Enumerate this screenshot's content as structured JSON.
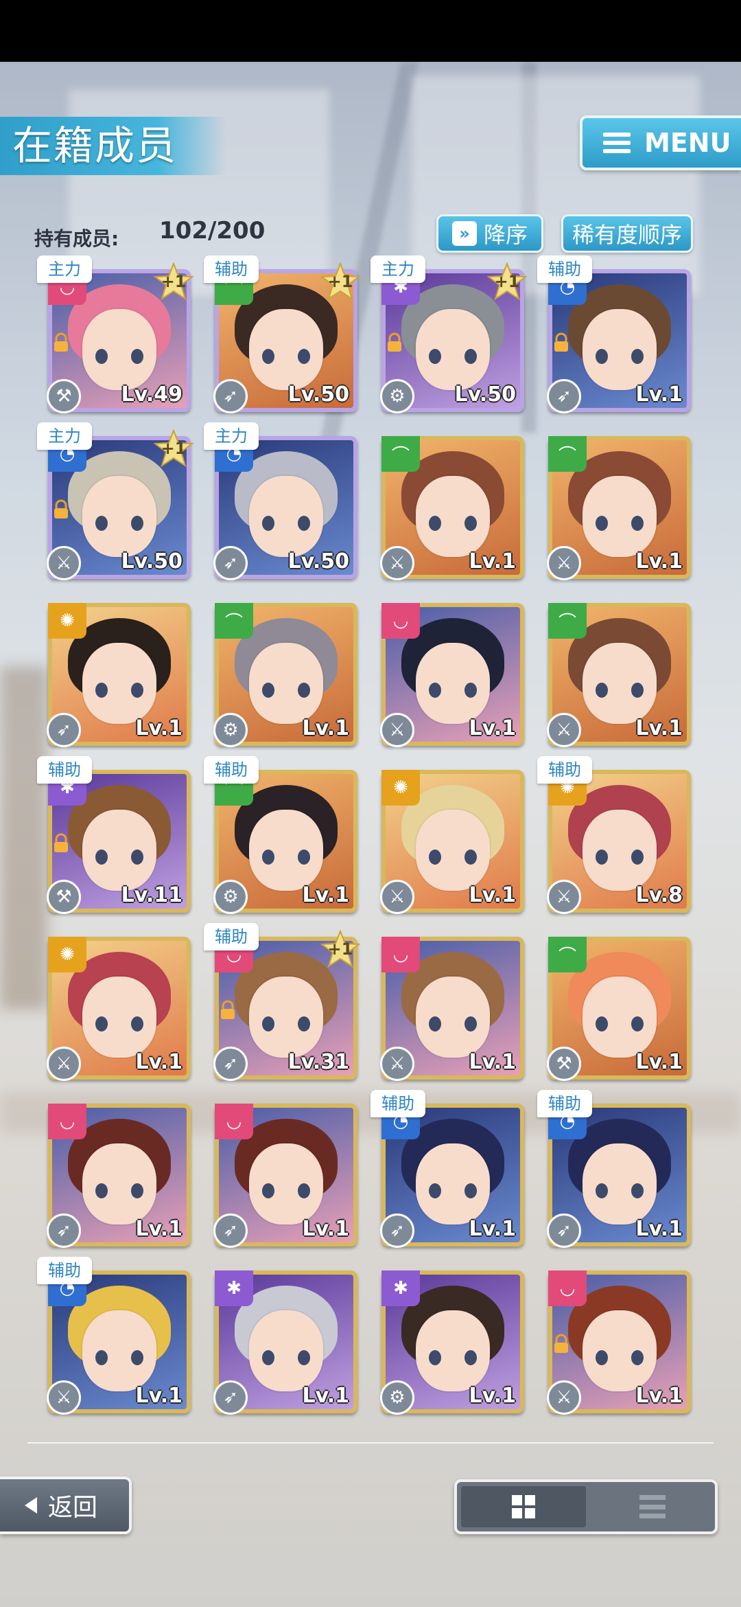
{
  "header": {
    "title": "在籍成员",
    "menu_label": "MENU"
  },
  "members": {
    "label": "持有成员:",
    "count": "102/200"
  },
  "sort": {
    "order_label": "降序",
    "order_icon": "double-chevron-down-icon",
    "key_label": "稀有度顺序"
  },
  "colors": {
    "accent": "#2e9cc8",
    "attr_pink": "#e24a7a",
    "attr_green": "#3eab46",
    "attr_orange": "#e6a21d",
    "attr_blue": "#2f6fd1",
    "attr_purple": "#8c5bd1",
    "gold_frame": "#d9b85a",
    "rainbow_frame": "#b9a4e6"
  },
  "cards": [
    {
      "role": "主力",
      "plus": "+1",
      "level": "Lv.49",
      "attr": "pink",
      "frame": "rainbow",
      "lock": true,
      "weapon": "hammer-icon",
      "hair": "#e77a9a"
    },
    {
      "role": "辅助",
      "plus": "+1",
      "level": "Lv.50",
      "attr": "green",
      "frame": "rainbow",
      "lock": false,
      "weapon": "gun-icon",
      "hair": "#3b2a24"
    },
    {
      "role": "主力",
      "plus": "+1",
      "level": "Lv.50",
      "attr": "purple",
      "frame": "rainbow",
      "lock": true,
      "weapon": "gear-icon",
      "hair": "#8a8f95"
    },
    {
      "role": "辅助",
      "plus": "",
      "level": "Lv.1",
      "attr": "blue",
      "frame": "rainbow",
      "lock": true,
      "weapon": "gun-icon",
      "hair": "#6b4a34"
    },
    {
      "role": "主力",
      "plus": "+1",
      "level": "Lv.50",
      "attr": "blue",
      "frame": "rainbow",
      "lock": true,
      "weapon": "sword-icon",
      "hair": "#c9c3b3"
    },
    {
      "role": "主力",
      "plus": "",
      "level": "Lv.50",
      "attr": "blue",
      "frame": "rainbow",
      "lock": false,
      "weapon": "gun-icon",
      "hair": "#b9bcc8"
    },
    {
      "role": "",
      "plus": "",
      "level": "Lv.1",
      "attr": "green",
      "frame": "gold",
      "lock": false,
      "weapon": "sword-icon",
      "hair": "#8a4a34"
    },
    {
      "role": "",
      "plus": "",
      "level": "Lv.1",
      "attr": "green",
      "frame": "gold",
      "lock": false,
      "weapon": "sword-icon",
      "hair": "#8a4a34"
    },
    {
      "role": "",
      "plus": "",
      "level": "Lv.1",
      "attr": "orange",
      "frame": "gold",
      "lock": false,
      "weapon": "gun-icon",
      "hair": "#2a201c"
    },
    {
      "role": "",
      "plus": "",
      "level": "Lv.1",
      "attr": "green",
      "frame": "gold",
      "lock": false,
      "weapon": "gear-icon",
      "hair": "#8f8a96"
    },
    {
      "role": "",
      "plus": "",
      "level": "Lv.1",
      "attr": "pink",
      "frame": "gold",
      "lock": false,
      "weapon": "sword-icon",
      "hair": "#1f2338"
    },
    {
      "role": "",
      "plus": "",
      "level": "Lv.1",
      "attr": "green",
      "frame": "gold",
      "lock": false,
      "weapon": "sword-icon",
      "hair": "#7a4a34"
    },
    {
      "role": "辅助",
      "plus": "",
      "level": "Lv.11",
      "attr": "purple",
      "frame": "gold",
      "lock": true,
      "weapon": "hammer-icon",
      "hair": "#8a5a34"
    },
    {
      "role": "辅助",
      "plus": "",
      "level": "Lv.1",
      "attr": "green",
      "frame": "gold",
      "lock": false,
      "weapon": "gear-icon",
      "hair": "#2a2226"
    },
    {
      "role": "",
      "plus": "",
      "level": "Lv.1",
      "attr": "orange",
      "frame": "gold",
      "lock": false,
      "weapon": "sword-icon",
      "hair": "#e6d39a"
    },
    {
      "role": "辅助",
      "plus": "",
      "level": "Lv.8",
      "attr": "orange",
      "frame": "gold",
      "lock": false,
      "weapon": "sword-icon",
      "hair": "#b0424f"
    },
    {
      "role": "",
      "plus": "",
      "level": "Lv.1",
      "attr": "orange",
      "frame": "gold",
      "lock": false,
      "weapon": "sword-icon",
      "hair": "#b8424f"
    },
    {
      "role": "辅助",
      "plus": "+1",
      "level": "Lv.31",
      "attr": "pink",
      "frame": "gold",
      "lock": true,
      "weapon": "gun-icon",
      "hair": "#9a6a44"
    },
    {
      "role": "",
      "plus": "",
      "level": "Lv.1",
      "attr": "pink",
      "frame": "gold",
      "lock": false,
      "weapon": "sword-icon",
      "hair": "#9a6a44"
    },
    {
      "role": "",
      "plus": "",
      "level": "Lv.1",
      "attr": "green",
      "frame": "gold",
      "lock": false,
      "weapon": "hammer-icon",
      "hair": "#f08a5a"
    },
    {
      "role": "",
      "plus": "",
      "level": "Lv.1",
      "attr": "pink",
      "frame": "gold",
      "lock": false,
      "weapon": "gun-icon",
      "hair": "#6a2a24"
    },
    {
      "role": "",
      "plus": "",
      "level": "Lv.1",
      "attr": "pink",
      "frame": "gold",
      "lock": false,
      "weapon": "gun-icon",
      "hair": "#6a2a24"
    },
    {
      "role": "辅助",
      "plus": "",
      "level": "Lv.1",
      "attr": "blue",
      "frame": "gold",
      "lock": false,
      "weapon": "gun-icon",
      "hair": "#242a58"
    },
    {
      "role": "辅助",
      "plus": "",
      "level": "Lv.1",
      "attr": "blue",
      "frame": "gold",
      "lock": false,
      "weapon": "gun-icon",
      "hair": "#242a58"
    },
    {
      "role": "辅助",
      "plus": "",
      "level": "Lv.1",
      "attr": "blue",
      "frame": "gold",
      "lock": false,
      "weapon": "sword-icon",
      "hair": "#e6c04a"
    },
    {
      "role": "",
      "plus": "",
      "level": "Lv.1",
      "attr": "purple",
      "frame": "gold",
      "lock": false,
      "weapon": "gun-icon",
      "hair": "#c9c9d3"
    },
    {
      "role": "",
      "plus": "",
      "level": "Lv.1",
      "attr": "purple",
      "frame": "gold",
      "lock": false,
      "weapon": "gear-icon",
      "hair": "#3a2a24"
    },
    {
      "role": "",
      "plus": "",
      "level": "Lv.1",
      "attr": "pink",
      "frame": "gold",
      "lock": true,
      "weapon": "sword-icon",
      "hair": "#8a3a24"
    }
  ],
  "footer": {
    "back_label": "返回",
    "view_modes": [
      "grid-view-icon",
      "list-view-icon"
    ],
    "active_view": "grid"
  }
}
